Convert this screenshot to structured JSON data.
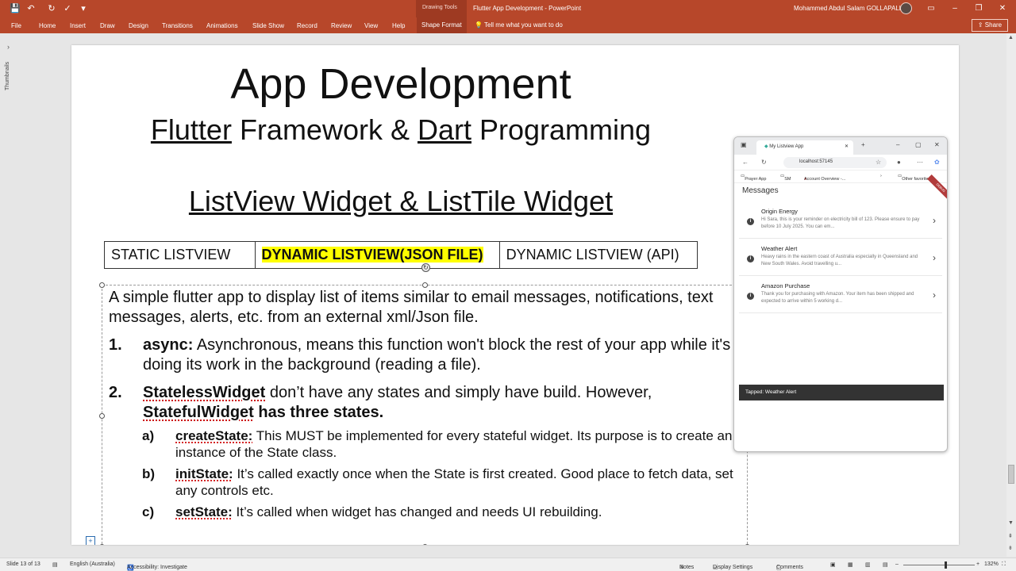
{
  "window": {
    "drawing_tools": "Drawing Tools",
    "doc_title": "Flutter App Development  -  PowerPoint",
    "user_name": "Mohammed Abdul Salam GOLLAPALLI"
  },
  "menu": {
    "items": [
      "File",
      "Home",
      "Insert",
      "Draw",
      "Design",
      "Transitions",
      "Animations",
      "Slide Show",
      "Record",
      "Review",
      "View",
      "Help",
      "Shape Format"
    ],
    "tell_me": "Tell me what you want to do",
    "share": "Share"
  },
  "thumbnails_label": "Thumbnails",
  "slide": {
    "title": "App Development",
    "subtitle_part1": "Flutter",
    "subtitle_part2": " Framework & ",
    "subtitle_part3": "Dart",
    "subtitle_part4": " Programming",
    "section_title": "ListView Widget & ListTile Widget",
    "tabs": [
      "STATIC LISTVIEW",
      "DYNAMIC LISTVIEW(JSON FILE)",
      "DYNAMIC LISTVIEW (API)"
    ],
    "intro": "A simple flutter app to display list of items similar to email messages, notifications, text messages, alerts, etc. from an external xml/Json file.",
    "item1_num": "1.",
    "item1_kw": "async:",
    "item1_text": " Asynchronous, means this function won't block the rest of your app while it's doing its work in the background (reading a file).",
    "item2_num": "2.",
    "item2_kw": "StatelessWidget",
    "item2_text": " don’t have any states and simply have build. However, ",
    "item2_kw2": "StatefulWidget",
    "item2_text2": " has three states.",
    "sub_items": [
      {
        "letter": "a)",
        "kw": "createState:",
        "text": " This MUST be implemented for every stateful widget. Its purpose is to create an instance of the State class."
      },
      {
        "letter": "b)",
        "kw": "initState:",
        "text": " It’s called exactly once when the State is first created. Good place to fetch data, set any controls etc."
      },
      {
        "letter": "c)",
        "kw": "setState:",
        "text": " It’s called when widget has changed and needs UI rebuilding."
      }
    ]
  },
  "browser": {
    "tab_title": "My Listview App",
    "url": "localhost:57145",
    "favorites": [
      "Prayer App",
      "SM",
      "Account Overview -...",
      "Other favorites"
    ],
    "app_title": "Messages",
    "debug": "DEBUG",
    "messages": [
      {
        "title": "Origin Energy",
        "body": "Hi Sara, this is your reminder on electricity bill of 123. Please ensure to pay before 10 July 2025. You can em..."
      },
      {
        "title": "Weather Alert",
        "body": "Heavy rains in the eastern coast of Australia especially in Queensland and New South Wales. Avoid travelling u..."
      },
      {
        "title": "Amazon Purchase",
        "body": "Thank you for purchasing with Amazon. Your item has been shipped and expected to arrive within 5 working d..."
      }
    ],
    "snackbar": "Tapped: Weather Alert"
  },
  "status": {
    "slide": "Slide 13 of 13",
    "language": "English (Australia)",
    "accessibility": "Accessibility: Investigate",
    "notes": "Notes",
    "display": "Display Settings",
    "comments": "Comments",
    "zoom": "132%"
  }
}
